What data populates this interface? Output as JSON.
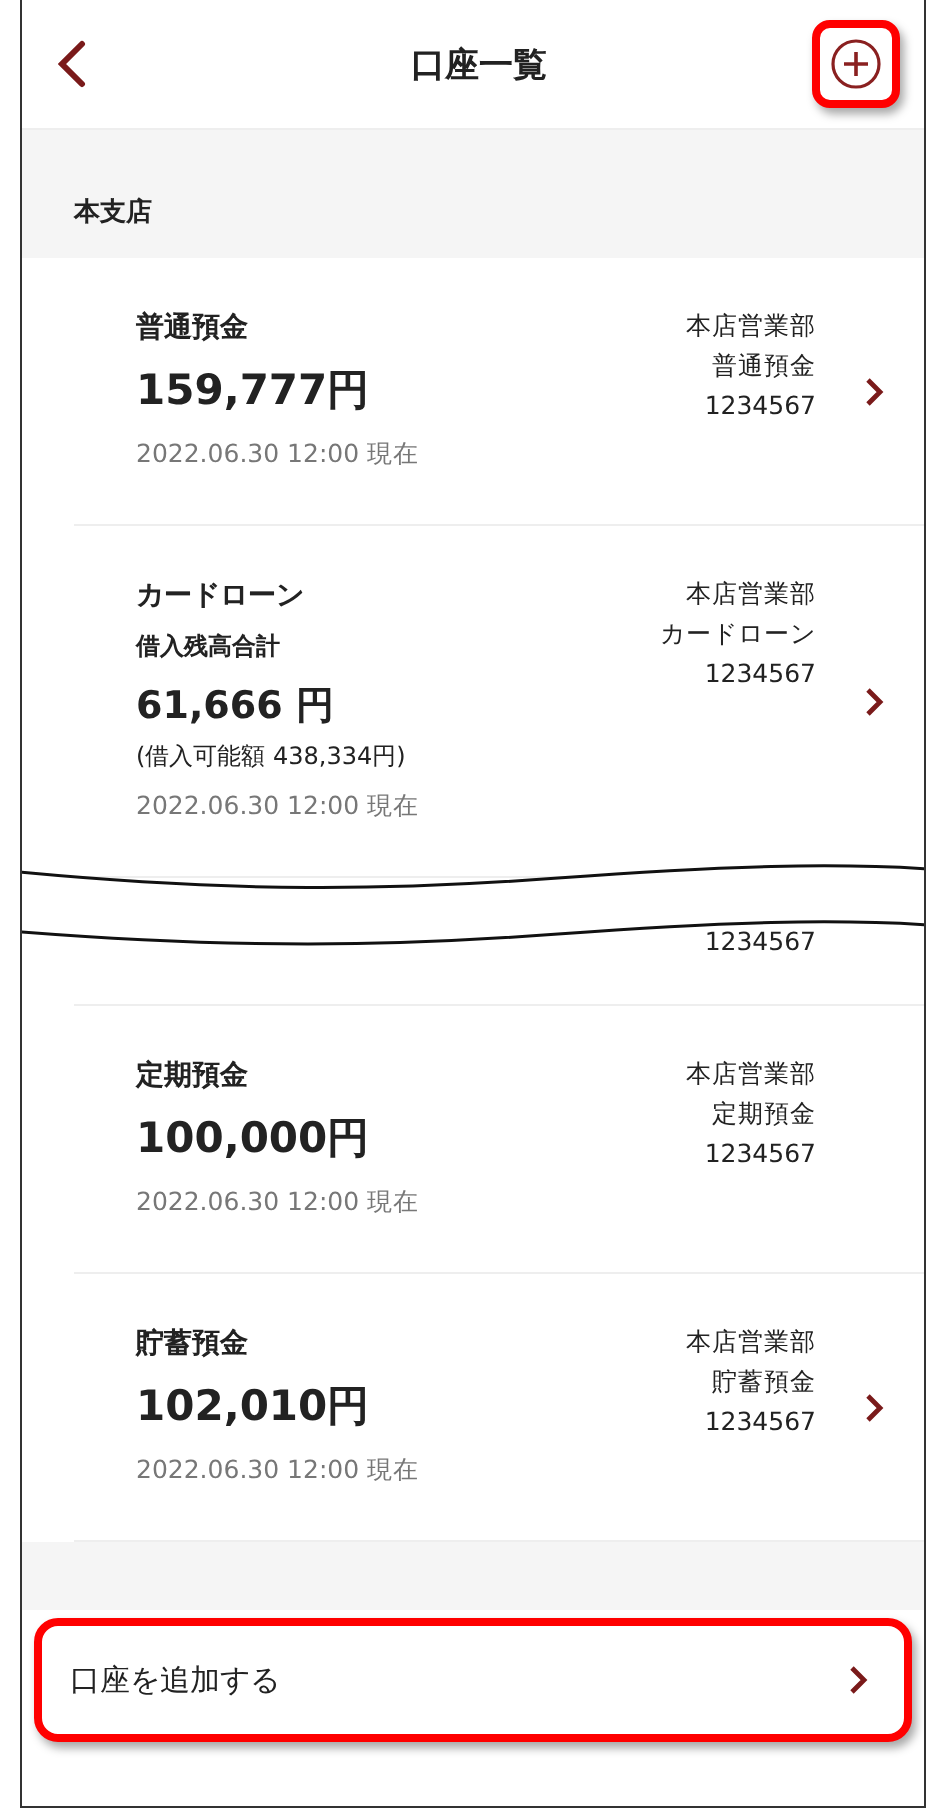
{
  "header": {
    "title": "口座一覧",
    "add_button_highlighted": true
  },
  "section": {
    "title": "本支店"
  },
  "accounts": [
    {
      "kind": "deposit",
      "name": "普通預金",
      "amount": "159,777円",
      "as_of": "2022.06.30 12:00 現在",
      "branch": "本店営業部",
      "type": "普通預金",
      "number": "1234567",
      "chevron": true
    },
    {
      "kind": "loan",
      "name": "カードローン",
      "sublabel": "借入残高合計",
      "amount": "61,666 円",
      "limit": "(借入可能額 438,334円)",
      "as_of": "2022.06.30 12:00 現在",
      "branch": "本店営業部",
      "type": "カードローン",
      "number": "1234567",
      "chevron": true
    },
    {
      "kind": "break"
    },
    {
      "kind": "fragment",
      "number": "1234567"
    },
    {
      "kind": "deposit",
      "name": "定期預金",
      "amount": "100,000円",
      "as_of": "2022.06.30 12:00 現在",
      "branch": "本店営業部",
      "type": "定期預金",
      "number": "1234567",
      "chevron": false
    },
    {
      "kind": "deposit",
      "name": "貯蓄預金",
      "amount": "102,010円",
      "as_of": "2022.06.30 12:00 現在",
      "branch": "本店営業部",
      "type": "貯蓄預金",
      "number": "1234567",
      "chevron": true
    }
  ],
  "add_account": {
    "label": "口座を追加する",
    "highlighted": true
  }
}
